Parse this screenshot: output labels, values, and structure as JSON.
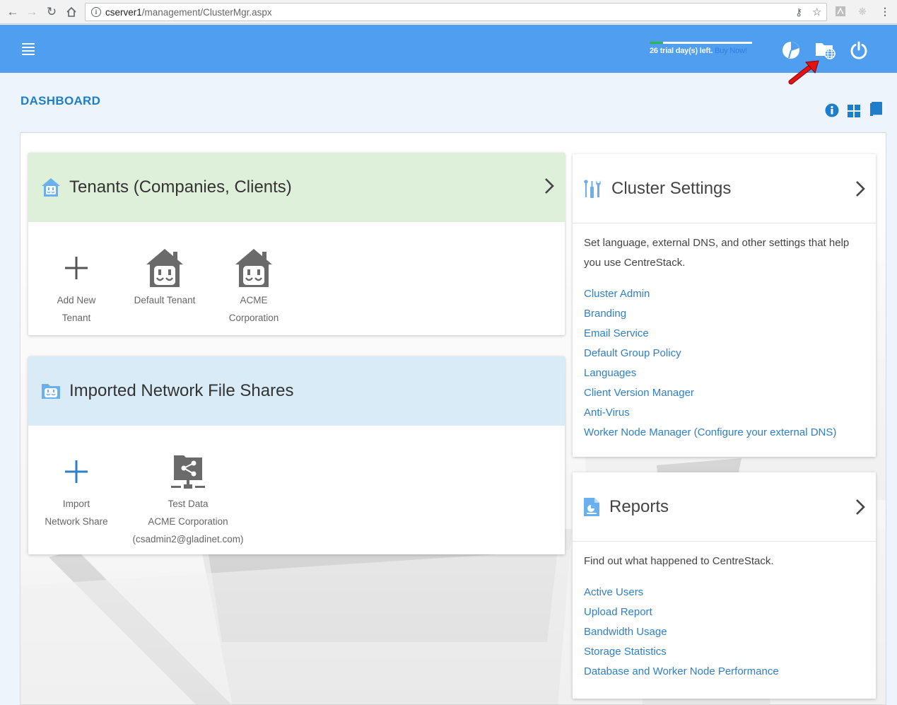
{
  "browser": {
    "url_host": "cserver1",
    "url_path": "/management/ClusterMgr.aspx"
  },
  "header": {
    "trial_text": "26 trial day(s) left.",
    "buy_now": "Buy Now!",
    "trial_progress": 0.13
  },
  "page_title": "DASHBOARD",
  "tenants": {
    "title": "Tenants (Companies, Clients)",
    "tiles": [
      {
        "label_line1": "Add New",
        "label_line2": "Tenant"
      },
      {
        "label_line1": "Default Tenant",
        "label_line2": ""
      },
      {
        "label_line1": "ACME",
        "label_line2": "Corporation"
      }
    ]
  },
  "shares": {
    "title": "Imported Network File Shares",
    "tiles": [
      {
        "label_line1": "Import",
        "label_line2": "Network Share",
        "label_line3": ""
      },
      {
        "label_line1": "Test Data",
        "label_line2": "ACME Corporation",
        "label_line3": "(csadmin2@gladinet.com)"
      }
    ]
  },
  "cluster_settings": {
    "title": "Cluster Settings",
    "description": "Set language, external DNS, and other settings that help you use CentreStack.",
    "links": [
      "Cluster Admin",
      "Branding",
      "Email Service",
      "Default Group Policy",
      "Languages",
      "Client Version Manager",
      "Anti-Virus",
      "Worker Node Manager (Configure your external DNS)"
    ]
  },
  "reports": {
    "title": "Reports",
    "description": "Find out what happened to CentreStack.",
    "links": [
      "Active Users",
      "Upload Report",
      "Bandwidth Usage",
      "Storage Statistics",
      "Database and Worker Node Performance"
    ]
  },
  "colors": {
    "header_blue": "#4f9ef0",
    "title_blue": "#1f7ec9",
    "tenants_head": "#dff0da",
    "shares_head": "#d9ebf6",
    "link_blue": "#2f7ec8"
  }
}
